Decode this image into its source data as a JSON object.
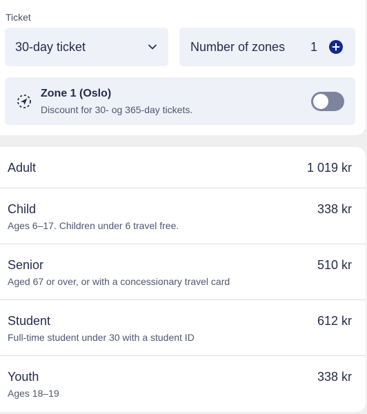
{
  "ticket": {
    "section_label": "Ticket",
    "type_select": {
      "value": "30-day ticket"
    },
    "zones": {
      "label": "Number of zones",
      "count": "1"
    },
    "zone_option": {
      "title": "Zone 1 (Oslo)",
      "subtitle": "Discount for 30- og 365-day tickets.",
      "toggle_on": false
    }
  },
  "travellers": [
    {
      "name": "Adult",
      "price": "1 019 kr",
      "desc": ""
    },
    {
      "name": "Child",
      "price": "338 kr",
      "desc": "Ages 6–17. Children under 6 travel free."
    },
    {
      "name": "Senior",
      "price": "510 kr",
      "desc": "Aged 67 or over, or with a concessionary travel card"
    },
    {
      "name": "Student",
      "price": "612 kr",
      "desc": "Full-time student under 30 with a student ID"
    },
    {
      "name": "Youth",
      "price": "338 kr",
      "desc": "Ages 18–19"
    }
  ],
  "colors": {
    "accent": "#132a8a",
    "field_bg": "#eff1f9",
    "toggle_off": "#7e849e"
  }
}
